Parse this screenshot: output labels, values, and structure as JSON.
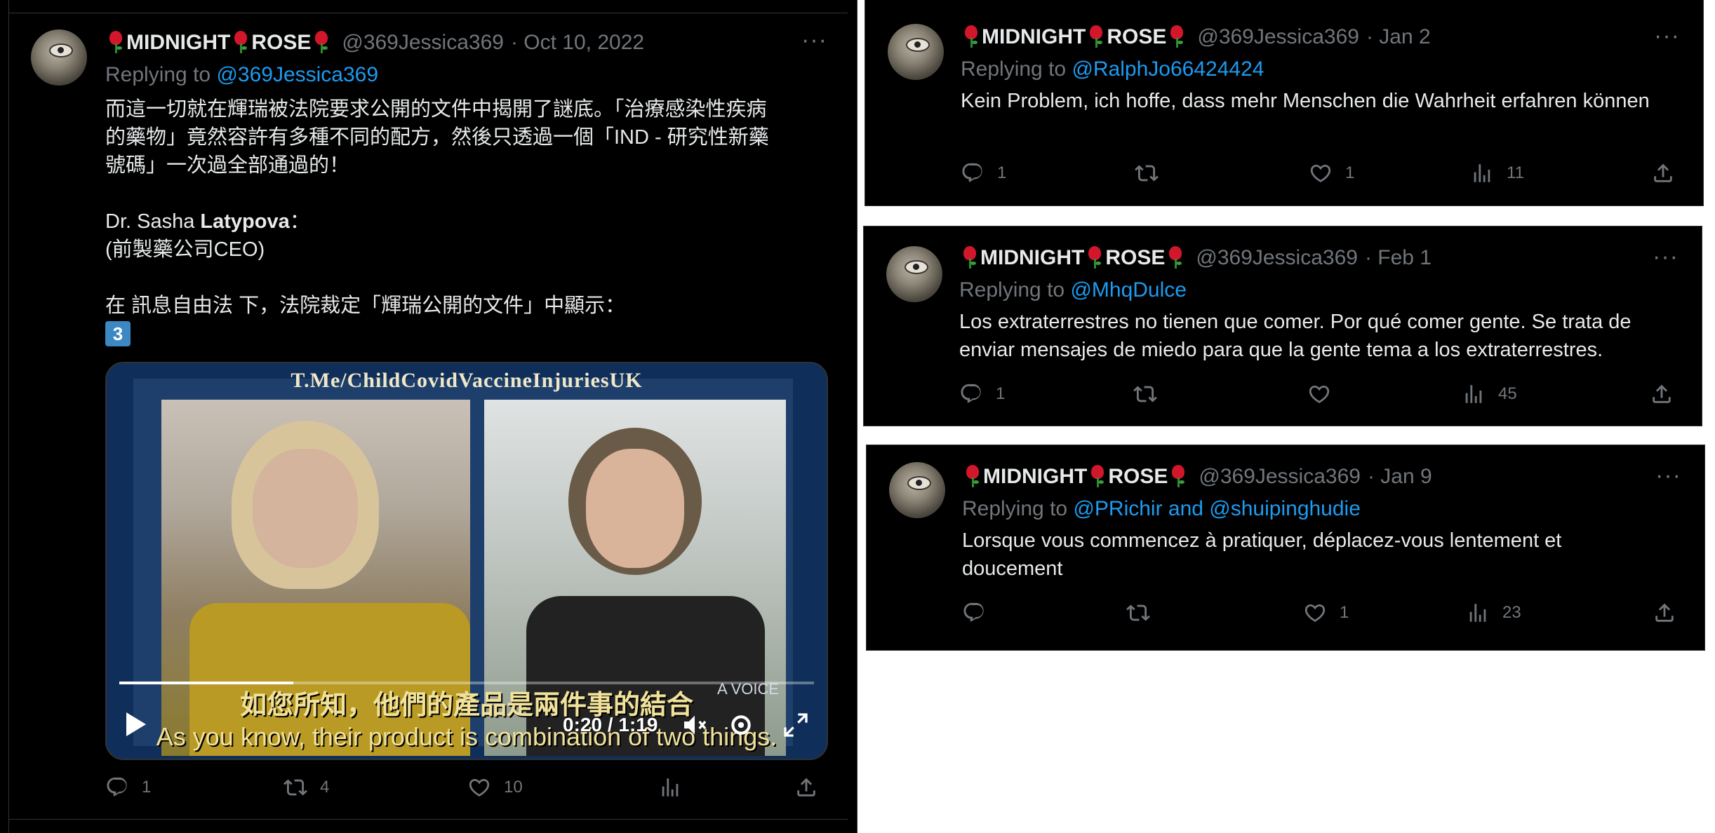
{
  "main_tweet": {
    "display_name": "MIDNIGHT",
    "display_name_2": "ROSE",
    "handle": "@369Jessica369",
    "date": "· Oct 10, 2022",
    "replying_prefix": "Replying to ",
    "replying_to": "@369Jessica369",
    "body_line_1": "而這一切就在輝瑞被法院要求公開的文件中揭開了謎底。「治療感染性疾病",
    "body_line_2": "的藥物」竟然容許有多種不同的配方，然後只透過一個「IND - 研究性新藥",
    "body_line_3": "號碼」一次過全部通過的！",
    "body_name_prefix": "Dr. Sasha ",
    "body_name_bold": "Latypova",
    "body_name_suffix": "：",
    "body_role": "(前製藥公司CEO)",
    "body_line_court": "在 訊息自由法 下，法院裁定「輝瑞公開的文件」中顯示：",
    "body_emoji": "3",
    "video": {
      "watermark": "T.Me/ChildCovidVaccineInjuriesUK",
      "subtitle_cn": "如您所知，他們的產品是兩件事的結合",
      "subtitle_en": "As you know, their product is combination of two things.",
      "time": "0:20 / 1:19",
      "progress": 0.25,
      "corner_text": "A VOICE"
    },
    "stats": {
      "replies": "1",
      "retweets": "4",
      "likes": "10",
      "views": ""
    }
  },
  "replies": [
    {
      "display_name": "MIDNIGHT",
      "display_name_2": "ROSE",
      "handle": "@369Jessica369",
      "date": "· Jan 2",
      "replying_prefix": "Replying to ",
      "replying_to": "@RalphJo66424424",
      "text": "Kein Problem, ich hoffe, dass mehr Menschen die Wahrheit erfahren können",
      "stats": {
        "replies": "1",
        "retweets": "",
        "likes": "1",
        "views": "11"
      }
    },
    {
      "display_name": "MIDNIGHT",
      "display_name_2": "ROSE",
      "handle": "@369Jessica369",
      "date": "· Feb 1",
      "replying_prefix": "Replying to ",
      "replying_to": "@MhqDulce",
      "text": "Los extraterrestres no tienen que comer.  Por qué comer gente.  Se trata de enviar mensajes de miedo para que la gente tema a los extraterrestres.",
      "stats": {
        "replies": "1",
        "retweets": "",
        "likes": "",
        "views": "45"
      }
    },
    {
      "display_name": "MIDNIGHT",
      "display_name_2": "ROSE",
      "handle": "@369Jessica369",
      "date": "· Jan 9",
      "replying_prefix": "Replying to ",
      "replying_to": "@PRichir and @shuipinghudie",
      "text": "Lorsque vous commencez à pratiquer, déplacez-vous lentement et doucement",
      "stats": {
        "replies": "",
        "retweets": "",
        "likes": "1",
        "views": "23"
      }
    }
  ],
  "icons": {
    "reply": "reply-icon",
    "retweet": "retweet-icon",
    "like": "heart-icon",
    "views": "views-icon",
    "share": "share-icon",
    "more": "more-icon"
  },
  "colors": {
    "background": "#000000",
    "text": "#e7e9ea",
    "muted": "#71767b",
    "link": "#1d9bf0"
  }
}
